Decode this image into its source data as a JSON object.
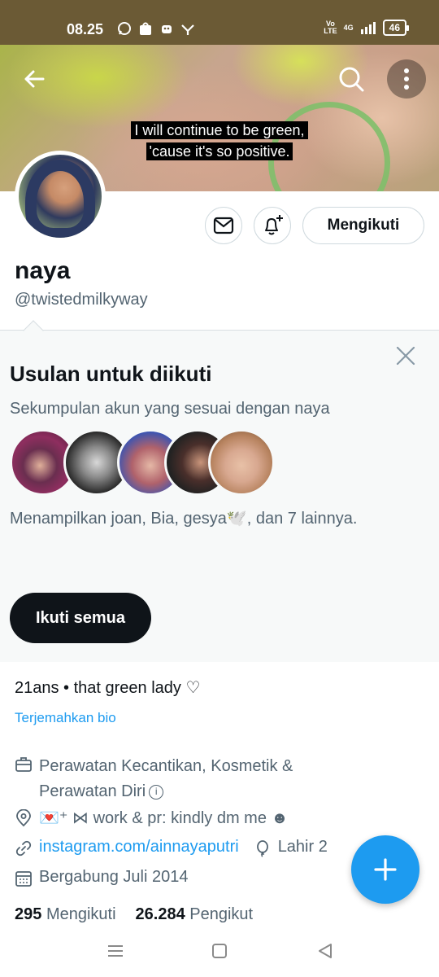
{
  "status_bar": {
    "time": "08.25",
    "network": "4G",
    "battery": "46",
    "app_icons": [
      "whatsapp-icon",
      "shopee-icon",
      "android-icon",
      "signal-icon"
    ]
  },
  "banner": {
    "subtitle_line1": "I will continue to be green,",
    "subtitle_line2": "'cause it's so positive."
  },
  "profile": {
    "name": "naya",
    "handle": "@twistedmilkyway",
    "follow_label": "Mengikuti",
    "bio": "21ans • that green lady ♡",
    "translate_bio": "Terjemahkan bio",
    "category": "Perawatan Kecantikan, Kosmetik & Perawatan Diri",
    "location": "💌⁺ ⋈ work & pr: kindly dm me ☻",
    "link": "instagram.com/ainnayaputri",
    "birth": "Lahir 2",
    "joined": "Bergabung Juli 2014",
    "following_count": "295",
    "following_label": "Mengikuti",
    "followers_count": "26.284",
    "followers_label": "Pengikut"
  },
  "suggestions": {
    "title": "Usulan untuk diikuti",
    "subtitle": "Sekumpulan akun yang sesuai dengan naya",
    "description": "Menampilkan joan, Bia, gesya🕊️, dan 7 lainnya.",
    "follow_all_label": "Ikuti semua"
  },
  "colors": {
    "accent": "#1d9bf0",
    "status_bar": "#6b5a35",
    "text_primary": "#0f1419",
    "text_secondary": "#536471",
    "panel_bg": "#f7f9f9"
  }
}
